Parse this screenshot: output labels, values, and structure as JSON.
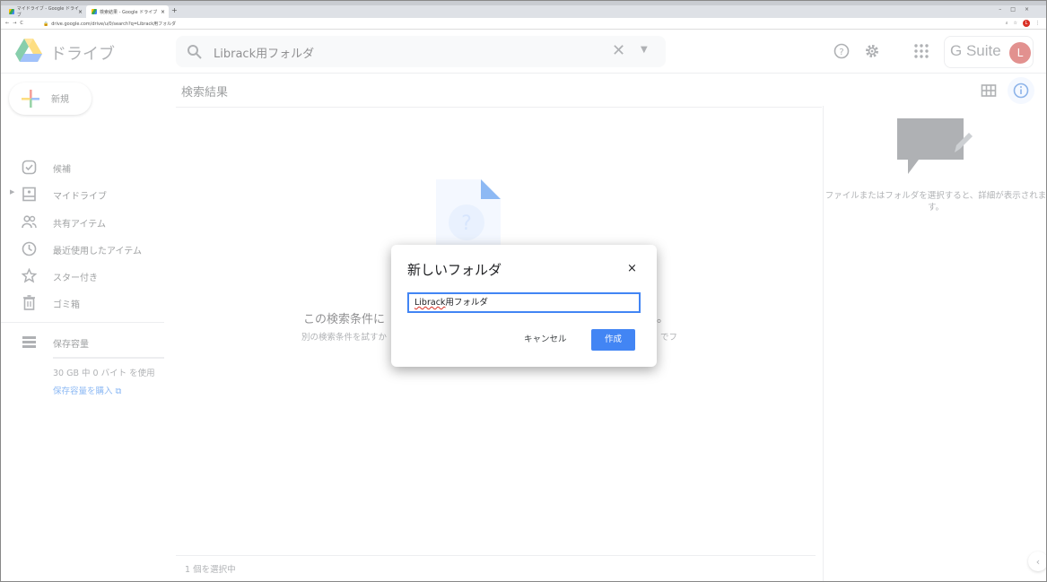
{
  "browser": {
    "tabs": [
      {
        "label": "マイドライブ - Google ドライブ"
      },
      {
        "label": "検索結果 - Google ドライブ"
      }
    ],
    "tab_close": "×",
    "new_tab": "+",
    "url": "drive.google.com/drive/u/0/search?q=Librack用フォルダ"
  },
  "header": {
    "brand": "ドライブ",
    "search_value": "Librack用フォルダ",
    "gsuite_label": "G Suite",
    "avatar_letter": "L"
  },
  "sidebar": {
    "new_label": "新規",
    "items": [
      {
        "label": "候補",
        "icon": "check-circle-icon"
      },
      {
        "label": "マイドライブ",
        "icon": "drive-icon"
      },
      {
        "label": "共有アイテム",
        "icon": "people-icon"
      },
      {
        "label": "最近使用したアイテム",
        "icon": "clock-icon"
      },
      {
        "label": "スター付き",
        "icon": "star-icon"
      },
      {
        "label": "ゴミ箱",
        "icon": "trash-icon"
      }
    ],
    "storage_label": "保存容量",
    "usage_text": "30 GB 中 0 バイト を使用",
    "buy_label": "保存容量を購入"
  },
  "main": {
    "title": "検索結果",
    "empty_title": "この検索条件に",
    "empty_title_tail": "。",
    "empty_sub": "別の検索条件を試すか",
    "empty_sub_tail": "でフ",
    "status": "1 個を選択中"
  },
  "details": {
    "text": "ファイルまたはフォルダを選択すると、詳細が表示されます。"
  },
  "dialog": {
    "title": "新しいフォルダ",
    "close": "×",
    "input_word": "Librack",
    "input_rest": "用フォルダ",
    "cancel_label": "キャンセル",
    "create_label": "作成"
  },
  "colors": {
    "accent": "#4285f4",
    "avatar": "#c5221f",
    "link": "#1a73e8"
  }
}
